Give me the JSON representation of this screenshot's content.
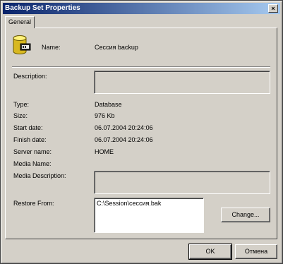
{
  "window": {
    "title": "Backup Set Properties",
    "close_glyph": "×"
  },
  "tabs": [
    {
      "label": "General",
      "selected": true
    }
  ],
  "header": {
    "icon": "database-icon",
    "name_label": "Name:",
    "name_value": "Сессия backup"
  },
  "fields": {
    "description_label": "Description:",
    "description_value": "",
    "type_label": "Type:",
    "type_value": "Database",
    "size_label": "Size:",
    "size_value": "976 Kb",
    "start_label": "Start date:",
    "start_value": "06.07.2004 20:24:06",
    "finish_label": "Finish date:",
    "finish_value": "06.07.2004 20:24:06",
    "server_label": "Server name:",
    "server_value": "HOME",
    "media_name_label": "Media Name:",
    "media_name_value": "",
    "media_desc_label": "Media Description:",
    "media_desc_value": "",
    "restore_label": "Restore From:",
    "restore_items": [
      "C:\\Session\\сессия.bak"
    ]
  },
  "buttons": {
    "change": "Change...",
    "ok": "OK",
    "cancel": "Отмена"
  },
  "colors": {
    "face": "#d4d0c8",
    "title_start": "#0a246a",
    "title_end": "#a6caf0"
  }
}
